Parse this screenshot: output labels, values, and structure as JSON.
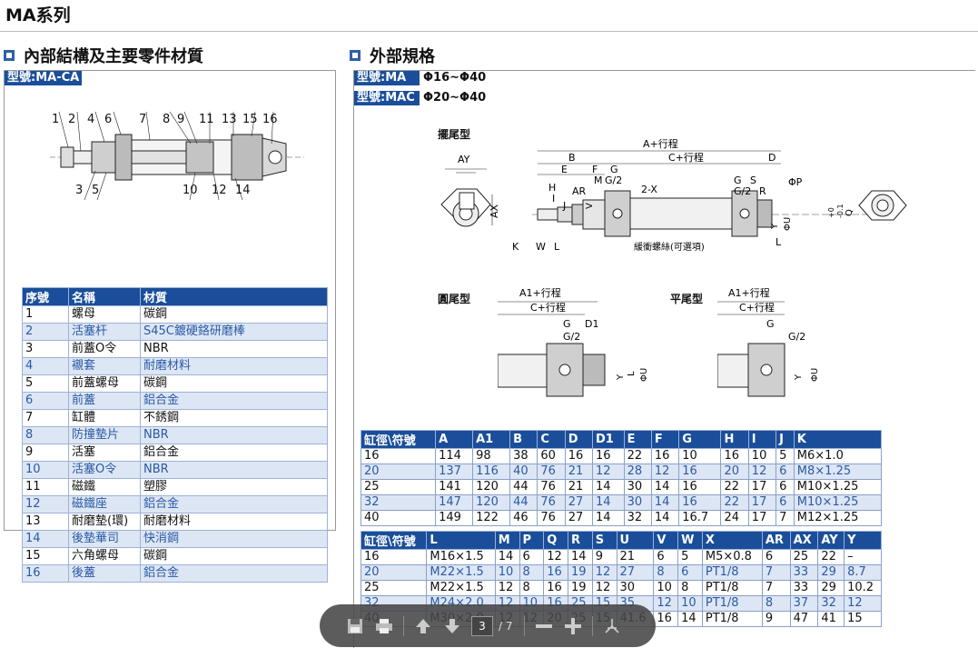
{
  "page_title": "MA系列",
  "left": {
    "heading": "內部結構及主要零件材質",
    "model": "型號:MA-CA",
    "callouts_top": [
      "1",
      "2",
      "4",
      "6",
      "7",
      "8",
      "9",
      "11",
      "13",
      "15",
      "16"
    ],
    "callouts_bottom": [
      "3",
      "5",
      "10",
      "12",
      "14"
    ],
    "table": {
      "headers": [
        "序號",
        "名稱",
        "材質"
      ],
      "rows": [
        [
          "1",
          "螺母",
          "碳鋼"
        ],
        [
          "2",
          "活塞杆",
          "S45C鍍硬鉻研磨棒"
        ],
        [
          "3",
          "前蓋O令",
          "NBR"
        ],
        [
          "4",
          "襯套",
          "耐磨材料"
        ],
        [
          "5",
          "前蓋螺母",
          "碳鋼"
        ],
        [
          "6",
          "前蓋",
          "鋁合金"
        ],
        [
          "7",
          "缸體",
          "不銹鋼"
        ],
        [
          "8",
          "防撞墊片",
          "NBR"
        ],
        [
          "9",
          "活塞",
          "鋁合金"
        ],
        [
          "10",
          "活塞O令",
          "NBR"
        ],
        [
          "11",
          "磁鐵",
          "塑膠"
        ],
        [
          "12",
          "磁鐵座",
          "鋁合金"
        ],
        [
          "13",
          "耐磨墊(環)",
          "耐磨材料"
        ],
        [
          "14",
          "後墊華司",
          "快消鋼"
        ],
        [
          "15",
          "六角螺母",
          "碳鋼"
        ],
        [
          "16",
          "後蓋",
          "鋁合金"
        ]
      ]
    }
  },
  "right": {
    "heading": "外部規格",
    "models": [
      {
        "tag": "型號:MA",
        "range": "Φ16~Φ40"
      },
      {
        "tag": "型號:MAC",
        "range": "Φ20~Φ40"
      }
    ],
    "drawing1": {
      "caption": "擺尾型",
      "labels": [
        "AY",
        "AX",
        "A+行程",
        "B",
        "C+行程",
        "D",
        "E",
        "F",
        "G",
        "G/2",
        "H",
        "I",
        "AR",
        "M",
        "J",
        "V",
        "2-X",
        "G",
        "S",
        "G/2",
        "R",
        "ΦP",
        "Y",
        "ΦU",
        "K",
        "W",
        "L",
        "緩衝螺絲(可選項)",
        "L",
        "Q"
      ],
      "tolerance_top": "+0",
      "tolerance_bottom": "-0.1"
    },
    "drawing2": {
      "caption": "圓尾型",
      "labels": [
        "A1+行程",
        "C+行程",
        "G",
        "D1",
        "G/2",
        "L",
        "Y",
        "ΦU"
      ]
    },
    "drawing3": {
      "caption": "平尾型",
      "labels": [
        "A1+行程",
        "C+行程",
        "G",
        "G/2",
        "Y",
        "ΦU"
      ]
    },
    "table1": {
      "headers": [
        "缸徑\\符號",
        "A",
        "A1",
        "B",
        "C",
        "D",
        "D1",
        "E",
        "F",
        "G",
        "H",
        "I",
        "J",
        "K"
      ],
      "rows": [
        [
          "16",
          "114",
          "98",
          "38",
          "60",
          "16",
          "16",
          "22",
          "16",
          "10",
          "16",
          "10",
          "5",
          "M6×1.0"
        ],
        [
          "20",
          "137",
          "116",
          "40",
          "76",
          "21",
          "12",
          "28",
          "12",
          "16",
          "20",
          "12",
          "6",
          "M8×1.25"
        ],
        [
          "25",
          "141",
          "120",
          "44",
          "76",
          "21",
          "14",
          "30",
          "14",
          "16",
          "22",
          "17",
          "6",
          "M10×1.25"
        ],
        [
          "32",
          "147",
          "120",
          "44",
          "76",
          "27",
          "14",
          "30",
          "14",
          "16",
          "22",
          "17",
          "6",
          "M10×1.25"
        ],
        [
          "40",
          "149",
          "122",
          "46",
          "76",
          "27",
          "14",
          "32",
          "14",
          "16.7",
          "24",
          "17",
          "7",
          "M12×1.25"
        ]
      ]
    },
    "table2": {
      "headers": [
        "缸徑\\符號",
        "L",
        "M",
        "P",
        "Q",
        "R",
        "S",
        "U",
        "V",
        "W",
        "X",
        "AR",
        "AX",
        "AY",
        "Y"
      ],
      "rows": [
        [
          "16",
          "M16×1.5",
          "14",
          "6",
          "12",
          "14",
          "9",
          "21",
          "6",
          "5",
          "M5×0.8",
          "6",
          "25",
          "22",
          "–"
        ],
        [
          "20",
          "M22×1.5",
          "10",
          "8",
          "16",
          "19",
          "12",
          "27",
          "8",
          "6",
          "PT1/8",
          "7",
          "33",
          "29",
          "8.7"
        ],
        [
          "25",
          "M22×1.5",
          "12",
          "8",
          "16",
          "19",
          "12",
          "30",
          "10",
          "8",
          "PT1/8",
          "7",
          "33",
          "29",
          "10.2"
        ],
        [
          "32",
          "M24×2.0",
          "12",
          "10",
          "16",
          "25",
          "15",
          "35",
          "12",
          "10",
          "PT1/8",
          "8",
          "37",
          "32",
          "12"
        ],
        [
          "40",
          "M30×2.0",
          "12",
          "12",
          "20",
          "25",
          "15",
          "41.6",
          "16",
          "14",
          "PT1/8",
          "9",
          "47",
          "41",
          "15"
        ]
      ]
    }
  },
  "toolbar": {
    "page_current": "3",
    "page_total": "/ 7"
  }
}
